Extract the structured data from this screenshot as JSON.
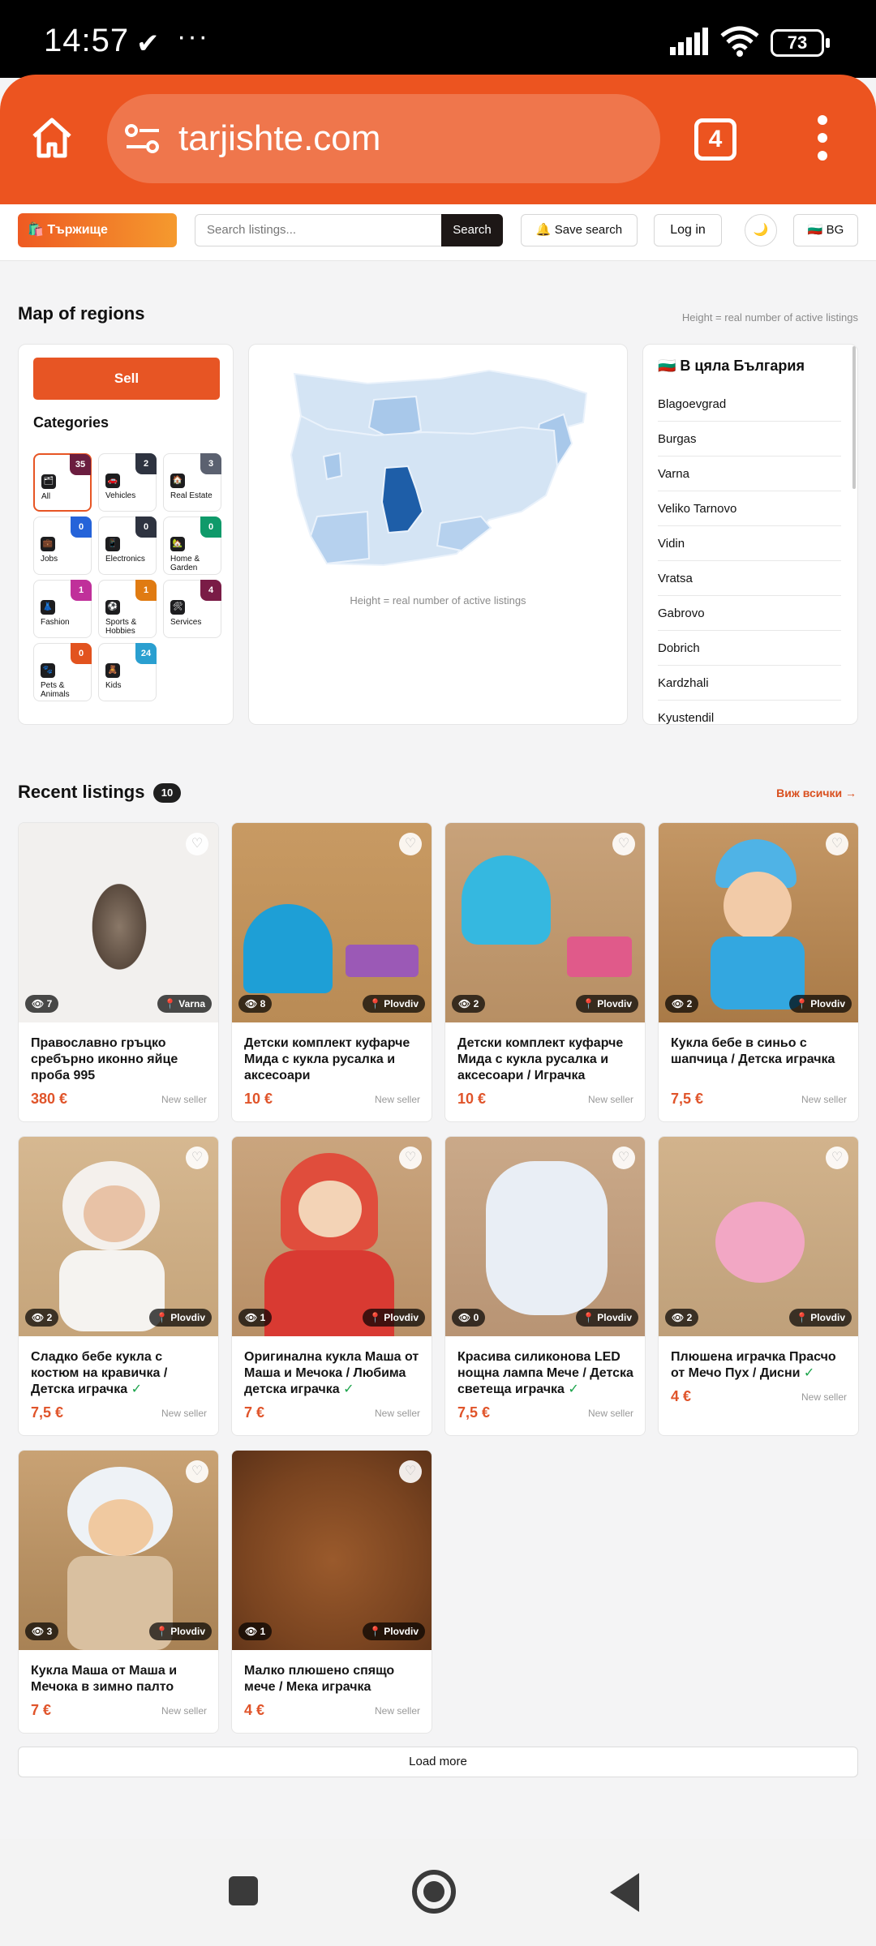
{
  "status_bar": {
    "time": "14:57",
    "battery": "73"
  },
  "browser": {
    "url": "tarjishte.com",
    "tab_count": "4"
  },
  "header": {
    "brand": "🛍️ Тържище",
    "search_placeholder": "Search listings...",
    "search_button": "Search",
    "save_search": "🔔 Save search",
    "login": "Log in",
    "theme_icon": "🌙",
    "language": "🇧🇬 BG"
  },
  "map_section": {
    "title": "Map of regions",
    "hint": "Height = real number of active listings",
    "sell_button": "Sell",
    "categories_title": "Categories",
    "categories": [
      {
        "label": "All",
        "count": "35",
        "icon": "🗂",
        "badge_color": "#6b1d3f"
      },
      {
        "label": "Vehicles",
        "count": "2",
        "icon": "🚗",
        "badge_color": "#2e3340"
      },
      {
        "label": "Real Estate",
        "count": "3",
        "icon": "🏠",
        "badge_color": "#5b6170"
      },
      {
        "label": "Jobs",
        "count": "0",
        "icon": "💼",
        "badge_color": "#2563d9"
      },
      {
        "label": "Electronics",
        "count": "0",
        "icon": "📱",
        "badge_color": "#2e3340"
      },
      {
        "label": "Home & Garden",
        "count": "0",
        "icon": "🏡",
        "badge_color": "#0f9a6a"
      },
      {
        "label": "Fashion",
        "count": "1",
        "icon": "👗",
        "badge_color": "#c0309a"
      },
      {
        "label": "Sports & Hobbies",
        "count": "1",
        "icon": "⚽",
        "badge_color": "#e07b12"
      },
      {
        "label": "Services",
        "count": "4",
        "icon": "🛠",
        "badge_color": "#7a1c46"
      },
      {
        "label": "Pets & Animals",
        "count": "0",
        "icon": "🐾",
        "badge_color": "#e2531f"
      },
      {
        "label": "Kids",
        "count": "24",
        "icon": "🧸",
        "badge_color": "#2a9fd0"
      }
    ],
    "map_hint": "Height = real number of active listings",
    "regions_title": "🇧🇬 В цяла България",
    "regions": [
      "Blagoevgrad",
      "Burgas",
      "Varna",
      "Veliko Tarnovo",
      "Vidin",
      "Vratsa",
      "Gabrovo",
      "Dobrich",
      "Kardzhali",
      "Kyustendil"
    ]
  },
  "listings": {
    "title": "Recent listings",
    "count": "10",
    "see_all": "Виж всички →",
    "seller_label": "New seller",
    "items": [
      {
        "title": "Православно гръцко сребърно иконно яйце проба 995",
        "price": "380 €",
        "views": "👁 7",
        "location": "📍 Varna",
        "verified": ""
      },
      {
        "title": "Детски комплект куфарче Мида с кукла русалка и аксесоари",
        "price": "10 €",
        "views": "👁 8",
        "location": "📍 Plovdiv",
        "verified": ""
      },
      {
        "title": "Детски комплект куфарче Мида с кукла русалка и аксесоари / Играчка",
        "price": "10 €",
        "views": "👁 2",
        "location": "📍 Plovdiv",
        "verified": ""
      },
      {
        "title": "Кукла бебе в синьо с шапчица / Детска играчка",
        "price": "7,5 €",
        "views": "👁 2",
        "location": "📍 Plovdiv",
        "verified": ""
      },
      {
        "title": "Сладко бебе кукла с костюм на кравичка / Детска играчка",
        "price": "7,5 €",
        "views": "👁 2",
        "location": "📍 Plovdiv",
        "verified": "✓"
      },
      {
        "title": "Оригинална кукла Маша от Маша и Мечока / Любима детска играчка",
        "price": "7 €",
        "views": "👁 1",
        "location": "📍 Plovdiv",
        "verified": "✓"
      },
      {
        "title": "Красива силиконова LED нощна лампа Мече / Детска светеща играчка",
        "price": "7,5 €",
        "views": "👁 0",
        "location": "📍 Plovdiv",
        "verified": "✓"
      },
      {
        "title": "Плюшена играчка Прасчо от Мечо Пух / Дисни",
        "price": "4 €",
        "views": "👁 2",
        "location": "📍 Plovdiv",
        "verified": "✓"
      },
      {
        "title": "Кукла Маша от Маша и Мечока в зимно палто",
        "price": "7 €",
        "views": "👁 3",
        "location": "📍 Plovdiv",
        "verified": ""
      },
      {
        "title": "Малко плюшено спящо мече / Мека играчка",
        "price": "4 €",
        "views": "👁 1",
        "location": "📍 Plovdiv",
        "verified": ""
      }
    ],
    "load_more": "Load more"
  },
  "colors": {
    "accent": "#ec5420",
    "price": "#e0542a",
    "dark": "#1d1716"
  }
}
